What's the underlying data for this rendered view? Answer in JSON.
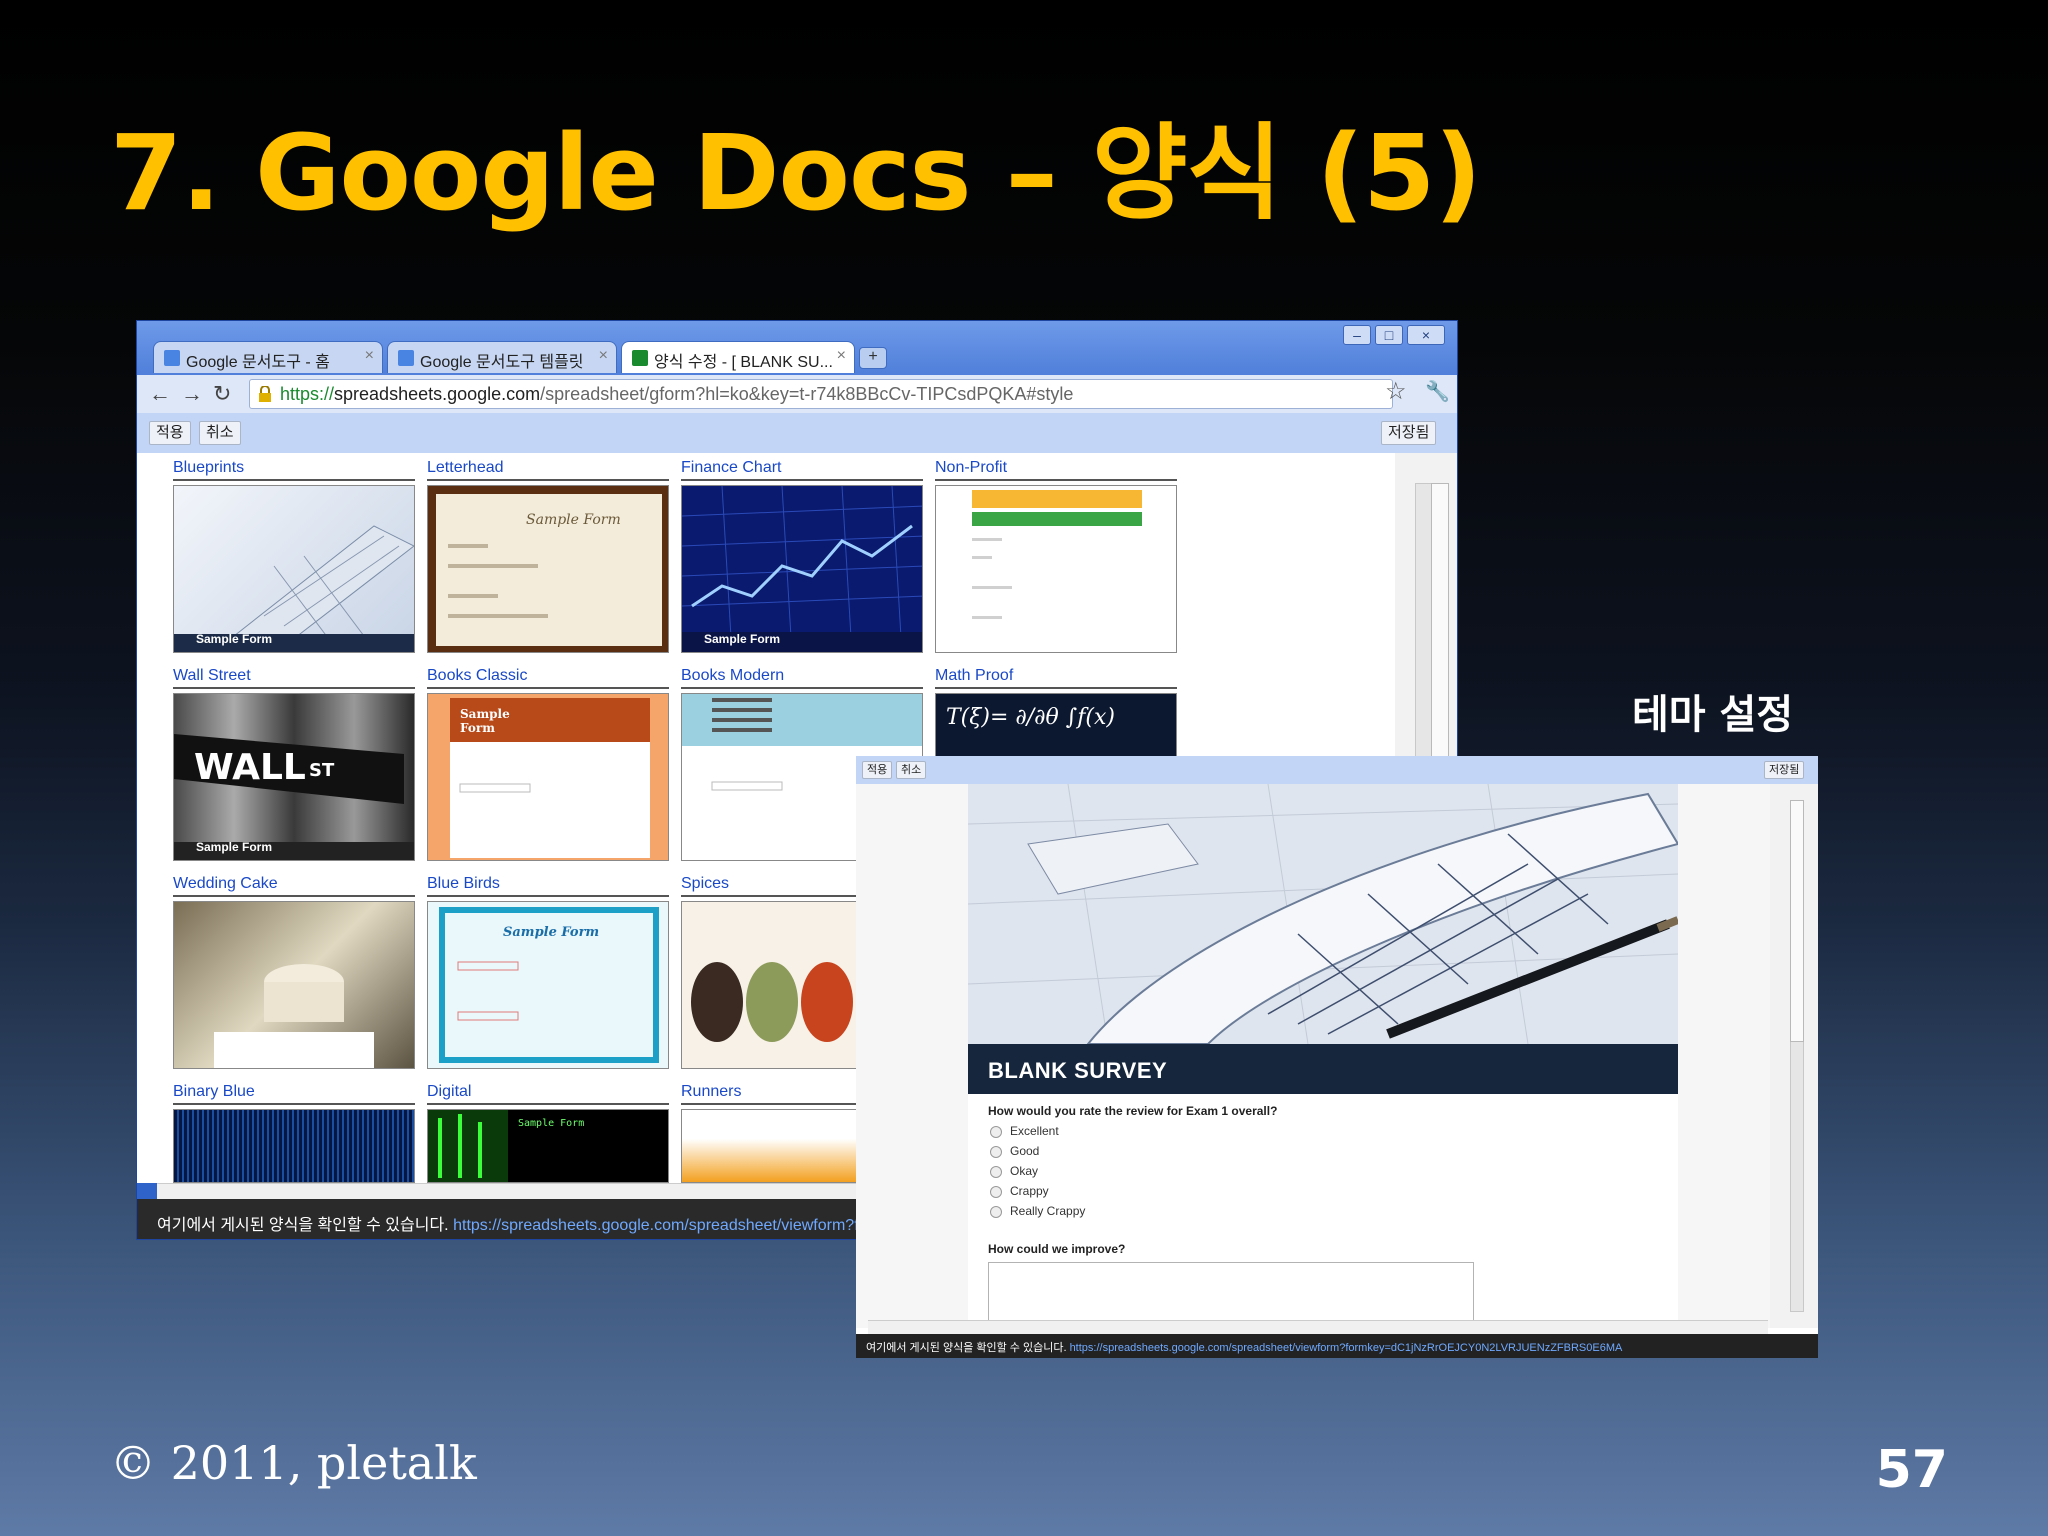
{
  "slide": {
    "title": "7. Google Docs – 양식 (5)",
    "copyright": "© 2011, pletalk",
    "page_number": "57",
    "theme_label": "테마 설정"
  },
  "browser": {
    "tabs": [
      {
        "label": "Google 문서도구 - 홈"
      },
      {
        "label": "Google 문서도구 템플릿"
      },
      {
        "label": "양식 수정 - [ BLANK SU..."
      }
    ],
    "new_tab": "+",
    "url_scheme": "https://",
    "url_host": "spreadsheets.google.com",
    "url_path": "/spreadsheet/gform?hl=ko&key=t-r74k8BBcCv-TIPCsdPQKA#style",
    "apply_label": "적용",
    "cancel_label": "취소",
    "saved_label": "저장됨",
    "status_text": "여기에서 게시된 양식을 확인할 수 있습니다.",
    "status_link": "https://spreadsheets.google.com/spreadsheet/viewform?formk",
    "templates": [
      {
        "name": "Blueprints",
        "caption": "Sample Form"
      },
      {
        "name": "Letterhead",
        "caption": ""
      },
      {
        "name": "Finance Chart",
        "caption": "Sample Form"
      },
      {
        "name": "Non-Profit",
        "caption": ""
      },
      {
        "name": "Wall Street",
        "caption": "Sample Form"
      },
      {
        "name": "Books Classic",
        "caption": ""
      },
      {
        "name": "Books Modern",
        "caption": ""
      },
      {
        "name": "Math Proof",
        "caption": ""
      },
      {
        "name": "Wedding Cake",
        "caption": ""
      },
      {
        "name": "Blue Birds",
        "caption": ""
      },
      {
        "name": "Spices",
        "caption": ""
      },
      {
        "name": "Binary Blue",
        "caption": ""
      },
      {
        "name": "Digital",
        "caption": ""
      },
      {
        "name": "Runners",
        "caption": ""
      }
    ]
  },
  "theme_window": {
    "apply_label": "적용",
    "cancel_label": "취소",
    "saved_label": "저장됨",
    "survey_title": "BLANK SURVEY",
    "question1": "How would you rate the review for Exam 1 overall?",
    "options": [
      "Excellent",
      "Good",
      "Okay",
      "Crappy",
      "Really Crappy"
    ],
    "question2": "How could we improve?",
    "status_text": "여기에서 게시된 양식을 확인할 수 있습니다.",
    "status_link": "https://spreadsheets.google.com/spreadsheet/viewform?formkey=dC1jNzRrOEJCY0N2LVRJUENzZFBRS0E6MA"
  },
  "colors": {
    "title": "#ffc000",
    "link": "#1a49c7",
    "survey_header": "#16263d"
  }
}
